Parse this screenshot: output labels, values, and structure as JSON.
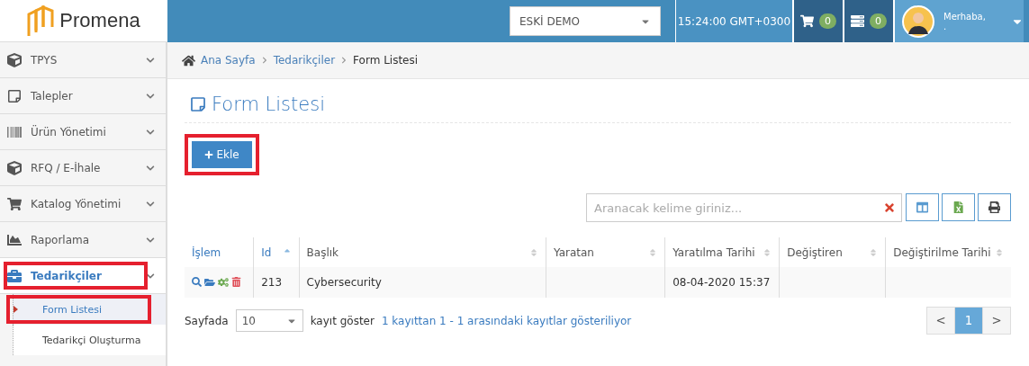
{
  "header": {
    "logo": "Promena",
    "company_select": "ESKİ DEMO",
    "time": "15:24:00 GMT+0300",
    "cart_count": "0",
    "server_count": "0",
    "greeting": "Merhaba,",
    "user_name": "."
  },
  "sidebar": {
    "items": [
      {
        "label": "TPYS",
        "kind": "cube",
        "selected": false,
        "highlighted": false
      },
      {
        "label": "Talepler",
        "kind": "note",
        "selected": false,
        "highlighted": false
      },
      {
        "label": "Ürün Yönetimi",
        "kind": "barcode",
        "selected": false,
        "highlighted": false
      },
      {
        "label": "RFQ / E-İhale",
        "kind": "cube",
        "selected": false,
        "highlighted": false
      },
      {
        "label": "Katalog Yönetimi",
        "kind": "cart",
        "selected": false,
        "highlighted": false
      },
      {
        "label": "Raporlama",
        "kind": "chart",
        "selected": false,
        "highlighted": false
      },
      {
        "label": "Tedarikçiler",
        "kind": "briefcase",
        "selected": true,
        "highlighted": true,
        "children": [
          {
            "label": "Form Listesi",
            "selected": true,
            "highlighted": true
          },
          {
            "label": "Tedarikçi Oluşturma",
            "selected": false,
            "highlighted": false
          }
        ]
      }
    ]
  },
  "breadcrumb": [
    {
      "label": "Ana Sayfa",
      "kind": "link"
    },
    {
      "label": "Tedarikçiler",
      "kind": "link"
    },
    {
      "label": "Form Listesi",
      "kind": "current"
    }
  ],
  "page_title": "Form Listesi",
  "add_button": {
    "label": "Ekle",
    "highlighted": true
  },
  "search": {
    "placeholder": "Aranacak kelime giriniz..."
  },
  "table": {
    "columns": [
      {
        "label": "İşlem",
        "kind": "actions",
        "sorted": false
      },
      {
        "label": "Id",
        "kind": "data",
        "sorted": true
      },
      {
        "label": "Başlık",
        "kind": "data",
        "sorted": false
      },
      {
        "label": "Yaratan",
        "kind": "data",
        "sorted": false
      },
      {
        "label": "Yaratılma Tarihi",
        "kind": "data",
        "sorted": false
      },
      {
        "label": "Değiştiren",
        "kind": "data",
        "sorted": false
      },
      {
        "label": "Değiştirilme Tarihi",
        "kind": "data",
        "sorted": false
      }
    ],
    "rows": [
      {
        "id": "213",
        "title": "Cybersecurity",
        "created_at": "08-04-2020 15:37"
      }
    ]
  },
  "footer": {
    "per_page_label": "Sayfada",
    "per_page": "10",
    "per_page_suffix": "kayıt göster",
    "info": "1 kayıttan 1 - 1 arasındaki kayıtlar gösteriliyor",
    "pages": [
      {
        "label": "<",
        "selected": false
      },
      {
        "label": "1",
        "selected": true
      },
      {
        "label": ">",
        "selected": false
      }
    ]
  }
}
